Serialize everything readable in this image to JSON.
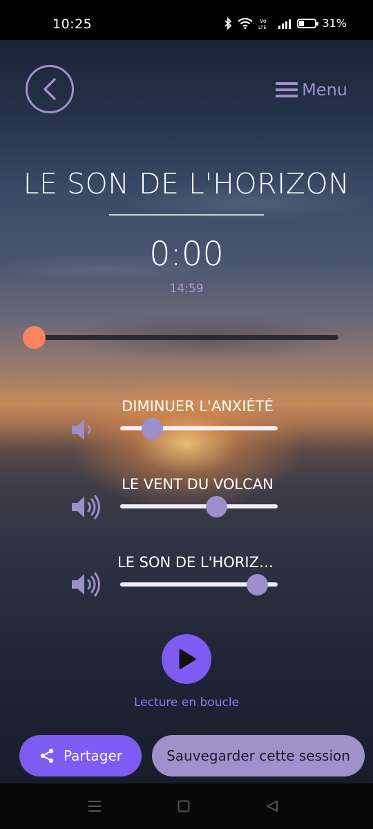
{
  "status_bar": {
    "time": "10:25",
    "volte": "Vo\nLTE",
    "battery_percent": "31%",
    "battery_level": 0.31
  },
  "header": {
    "back_icon": "chevron-left-icon",
    "menu_icon": "hamburger-icon",
    "menu_label": "Menu"
  },
  "player": {
    "title": "LE SON DE L'HORIZON",
    "elapsed": "0:00",
    "duration": "14:59",
    "progress": 0.0
  },
  "layers": [
    {
      "label": "DIMINUER L'ANXIÉTÉ",
      "volume": 0.2,
      "speaker_icon": "speaker-low-icon"
    },
    {
      "label": "LE VENT DU VOLCAN",
      "volume": 0.61,
      "speaker_icon": "speaker-high-icon"
    },
    {
      "label": "LE SON DE L'HORIZON",
      "volume": 0.87,
      "speaker_icon": "speaker-high-icon"
    }
  ],
  "controls": {
    "play_icon": "play-icon",
    "loop_label": "Lecture en boucle"
  },
  "actions": {
    "share_label": "Partager",
    "share_icon": "share-icon",
    "save_label": "Sauvegarder cette session"
  },
  "colors": {
    "accent": "#7c5cf2",
    "lavender": "#9f91cc",
    "progress_thumb": "#fb8362"
  }
}
